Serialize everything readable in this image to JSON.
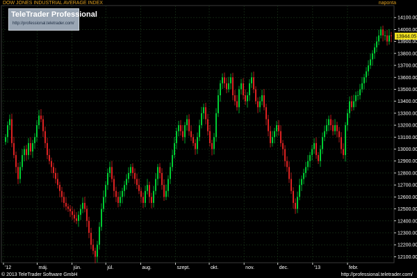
{
  "header": {
    "title": "DOW JONES INDUSTRIAL AVERAGE INDEX",
    "timeframe": "naponta"
  },
  "badge": {
    "brand": "TeleTrader Professional",
    "url": "http://professional.teletrader.com/"
  },
  "footer": {
    "copyright": "© 2013 TeleTrader Software GmbH",
    "url": "http://professional.teletrader.com/"
  },
  "colors": {
    "background": "#000000",
    "up": "#00cc33",
    "down": "#dd2222",
    "grid": "#1c3a1c",
    "axis": "#ffffff",
    "last_price_bg": "#f0e020"
  },
  "chart_data": {
    "type": "candlestick",
    "title": "DOW JONES INDUSTRIAL AVERAGE INDEX",
    "ylim": [
      12050,
      14200
    ],
    "y_ticks": [
      "12100.00",
      "12200.00",
      "12300.00",
      "12400.00",
      "12500.00",
      "12600.00",
      "12700.00",
      "12800.00",
      "12900.00",
      "13000.00",
      "13100.00",
      "13200.00",
      "13300.00",
      "13400.00",
      "13500.00",
      "13600.00",
      "13700.00",
      "13800.00",
      "13900.00",
      "14000.00",
      "14100.00"
    ],
    "x_labels": [
      {
        "label": "'12",
        "date": "2012-04-01"
      },
      {
        "label": "máj.",
        "date": "2012-05-01"
      },
      {
        "label": "jún.",
        "date": "2012-06-01"
      },
      {
        "label": "júl.",
        "date": "2012-07-01"
      },
      {
        "label": "aug.",
        "date": "2012-08-01"
      },
      {
        "label": "szept.",
        "date": "2012-09-01"
      },
      {
        "label": "okt.",
        "date": "2012-10-01"
      },
      {
        "label": "nov.",
        "date": "2012-11-01"
      },
      {
        "label": "dec.",
        "date": "2012-12-01"
      },
      {
        "label": "'13",
        "date": "2013-01-01"
      },
      {
        "label": "febr.",
        "date": "2013-02-01"
      }
    ],
    "last_value": "13944.05",
    "grid": true,
    "series": [
      {
        "close": [
          13100,
          13200,
          13250,
          13050,
          12950,
          12850,
          12750,
          12850,
          12950,
          13000,
          12950,
          13050,
          12980,
          13050,
          13100,
          13200,
          13280,
          13250,
          13150,
          13050,
          12950,
          12900,
          12850,
          12800,
          12750,
          12700,
          12650,
          12600,
          12550,
          12520,
          12500,
          12480,
          12450,
          12420,
          12400,
          12450,
          12500,
          12550,
          12500,
          12400,
          12300,
          12200,
          12150,
          12100,
          12200,
          12350,
          12500,
          12600,
          12700,
          12800,
          12850,
          12750,
          12650,
          12600,
          12550,
          12600,
          12650,
          12700,
          12750,
          12800,
          12850,
          12800,
          12750,
          12700,
          12650,
          12600,
          12550,
          12650,
          12700,
          12600,
          12550,
          12650,
          12750,
          12850,
          12800,
          12700,
          12600,
          12650,
          12750,
          12850,
          12950,
          13050,
          13150,
          13200,
          13150,
          13100,
          13200,
          13250,
          13150,
          13100,
          13050,
          13000,
          13100,
          13200,
          13300,
          13350,
          13250,
          13150,
          13050,
          13000,
          13100,
          13300,
          13450,
          13550,
          13600,
          13550,
          13500,
          13550,
          13600,
          13450,
          13400,
          13350,
          13500,
          13550,
          13450,
          13400,
          13450,
          13550,
          13600,
          13500,
          13400,
          13350,
          13400,
          13450,
          13350,
          13250,
          13150,
          13050,
          13100,
          13150,
          13200,
          13150,
          13050,
          13000,
          12900,
          12850,
          12750,
          12650,
          12550,
          12500,
          12600,
          12700,
          12750,
          12800,
          12850,
          12900,
          12950,
          13000,
          13050,
          12950,
          12900,
          13000,
          13100,
          13150,
          13200,
          13250,
          13200,
          13150,
          13200,
          13150,
          13100,
          13000,
          12950,
          13200,
          13300,
          13400,
          13350,
          13400,
          13450,
          13450,
          13500,
          13550,
          13600,
          13650,
          13700,
          13750,
          13800,
          13850,
          13900,
          13950,
          14000,
          13950,
          13950,
          13900,
          13950,
          13944
        ]
      }
    ]
  }
}
